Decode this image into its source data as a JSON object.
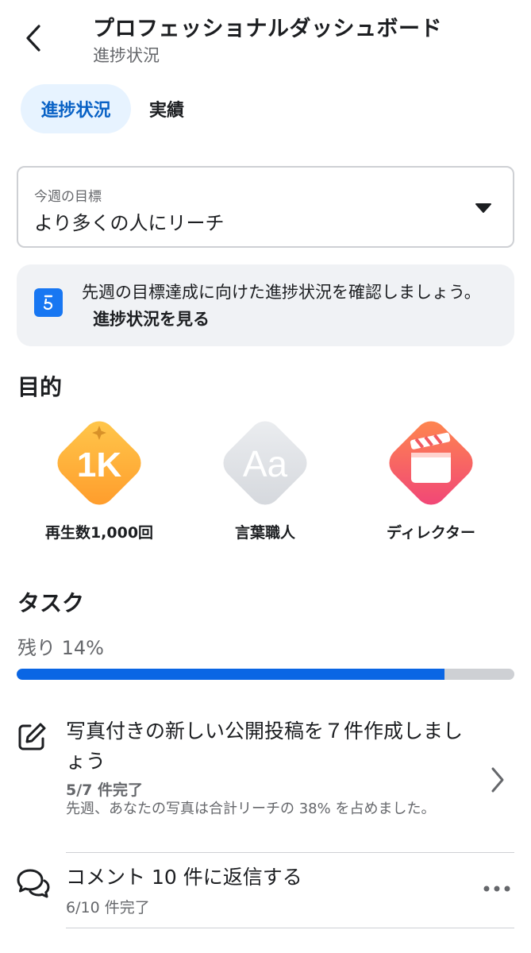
{
  "header": {
    "title": "プロフェッショナルダッシュボード",
    "subtitle": "進捗状況"
  },
  "tabs": [
    {
      "label": "進捗状況",
      "active": true
    },
    {
      "label": "実績",
      "active": false
    }
  ],
  "goal": {
    "label": "今週の目標",
    "value": "より多くの人にリーチ"
  },
  "info_card": {
    "text": "先週の目標達成に向けた進捗状況を確認しましょう。",
    "link": "進捗状況を見る"
  },
  "objectives": {
    "title": "目的",
    "badges": [
      {
        "label": "再生数1,000回",
        "icon": "1k-badge-icon",
        "badge_text": "1K"
      },
      {
        "label": "言葉職人",
        "icon": "aa-badge-icon",
        "badge_text": "Aa"
      },
      {
        "label": "ディレクター",
        "icon": "clapperboard-badge-icon"
      }
    ]
  },
  "tasks": {
    "title": "タスク",
    "remaining": "残り 14%",
    "progress_fraction": 0.86,
    "items": [
      {
        "title": "写真付きの新しい公開投稿を７件作成しましょう",
        "progress": "5/7 件完了",
        "description": "先週、あなたの写真は合計リーチの 38% を占めました。",
        "icon": "edit-icon",
        "action_icon": "chevron-right-icon"
      },
      {
        "title": "コメント 10 件に返信する",
        "progress": "6/10 件完了",
        "icon": "comments-icon",
        "action_icon": "more-icon"
      }
    ]
  },
  "colors": {
    "accent": "#0a66e4",
    "tab_active_bg": "#e7f3ff",
    "card_bg": "#f0f2f5"
  }
}
